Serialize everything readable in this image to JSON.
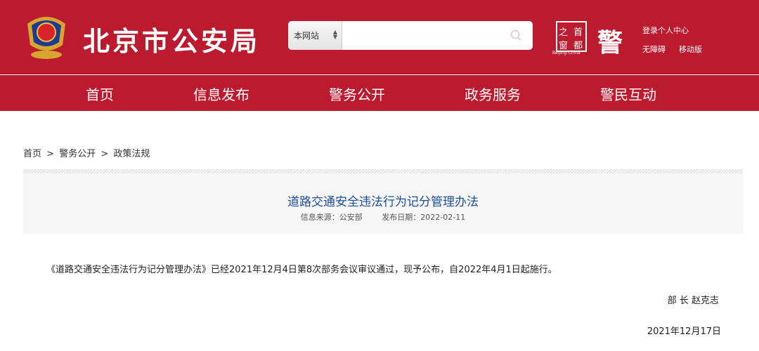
{
  "header": {
    "site_title": "北京市公安局",
    "search": {
      "scope": "本网站",
      "placeholder": ""
    },
    "logo_box": {
      "chars": [
        "之",
        "首",
        "窗",
        "都"
      ],
      "subtitle": "Beijing-China"
    },
    "logo2": "警",
    "links": {
      "login": "登录个人中心",
      "accessibility": "无障碍",
      "mobile": "移动版"
    }
  },
  "nav": [
    "首页",
    "信息发布",
    "警务公开",
    "政务服务",
    "警民互动"
  ],
  "breadcrumb": [
    "首页",
    ">",
    "警务公开",
    ">",
    "政策法规"
  ],
  "article": {
    "title": "道路交通安全违法行为记分管理办法",
    "source": "信息来源：公安部",
    "date": "发布日期：2022-02-11",
    "body": "《道路交通安全违法行为记分管理办法》已经2021年12月4日第8次部务会议审议通过，现予公布，自2022年4月1日起施行。",
    "signature": "部 长 赵克志",
    "sign_date": "2021年12月17日"
  }
}
